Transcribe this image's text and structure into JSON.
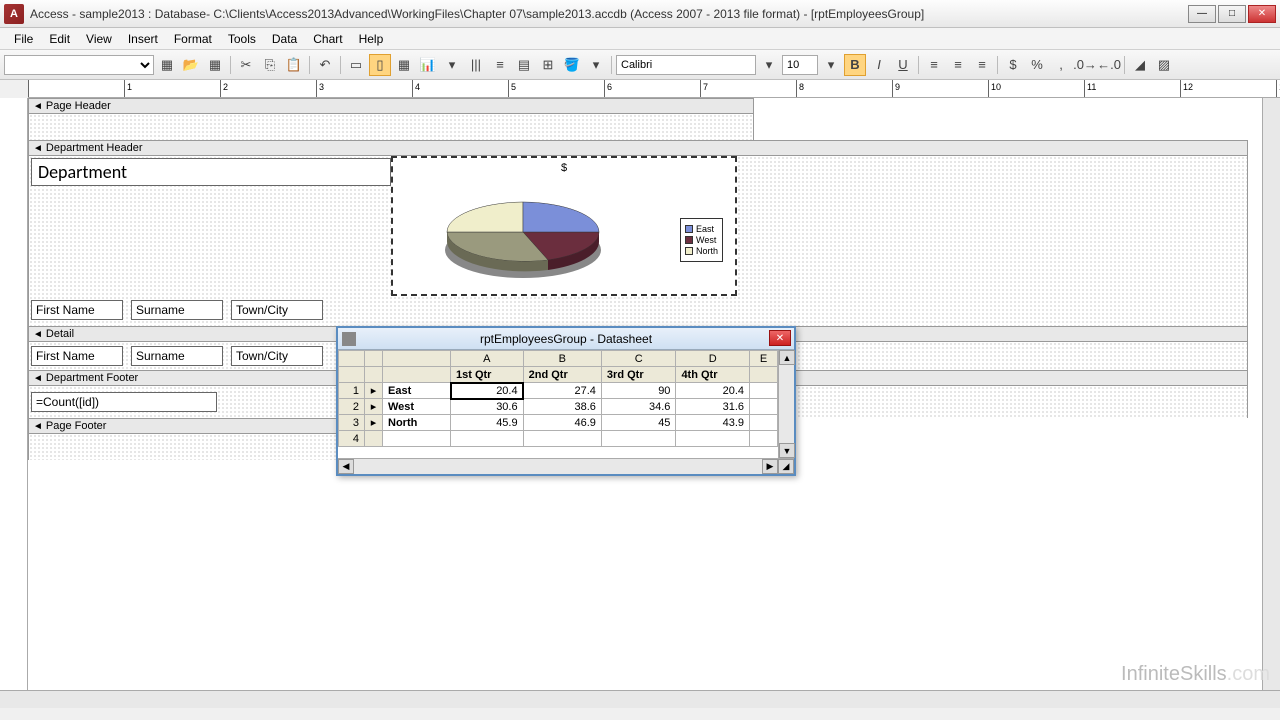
{
  "window": {
    "title": "Access - sample2013 : Database- C:\\Clients\\Access2013Advanced\\WorkingFiles\\Chapter 07\\sample2013.accdb (Access 2007 - 2013 file format) - [rptEmployeesGroup]",
    "app_abbrev": "A"
  },
  "menu": [
    "File",
    "Edit",
    "View",
    "Insert",
    "Format",
    "Tools",
    "Data",
    "Chart",
    "Help"
  ],
  "toolbar": {
    "font": "Calibri",
    "size": "10"
  },
  "ruler_max": 13,
  "sections": {
    "page_header": "Page Header",
    "dept_header": "Department Header",
    "detail": "Detail",
    "dept_footer": "Department Footer",
    "page_footer": "Page Footer"
  },
  "fields": {
    "department": "Department",
    "first_name": "First Name",
    "surname": "Surname",
    "town_city": "Town/City",
    "count_expr": "=Count([id])"
  },
  "chart": {
    "title": "$",
    "legend": [
      "East",
      "West",
      "North"
    ]
  },
  "datasheet": {
    "title": "rptEmployeesGroup - Datasheet",
    "cols": [
      "A",
      "B",
      "C",
      "D",
      "E"
    ],
    "headers": [
      "1st Qtr",
      "2nd Qtr",
      "3rd Qtr",
      "4th Qtr"
    ],
    "rows": [
      {
        "n": "1",
        "region": "East",
        "vals": [
          "20.4",
          "27.4",
          "90",
          "20.4"
        ]
      },
      {
        "n": "2",
        "region": "West",
        "vals": [
          "30.6",
          "38.6",
          "34.6",
          "31.6"
        ]
      },
      {
        "n": "3",
        "region": "North",
        "vals": [
          "45.9",
          "46.9",
          "45",
          "43.9"
        ]
      },
      {
        "n": "4",
        "region": "",
        "vals": [
          "",
          "",
          "",
          ""
        ]
      }
    ]
  },
  "chart_data": {
    "type": "pie",
    "title": "$",
    "categories": [
      "East",
      "West",
      "North"
    ],
    "values": [
      20.4,
      30.6,
      45.9
    ],
    "colors": [
      "#7b8fd9",
      "#6b2e3e",
      "#f0eecb"
    ],
    "legend_position": "right",
    "style": "3d"
  },
  "watermark": {
    "brand": "InfiniteSkills",
    "suffix": ".com"
  }
}
